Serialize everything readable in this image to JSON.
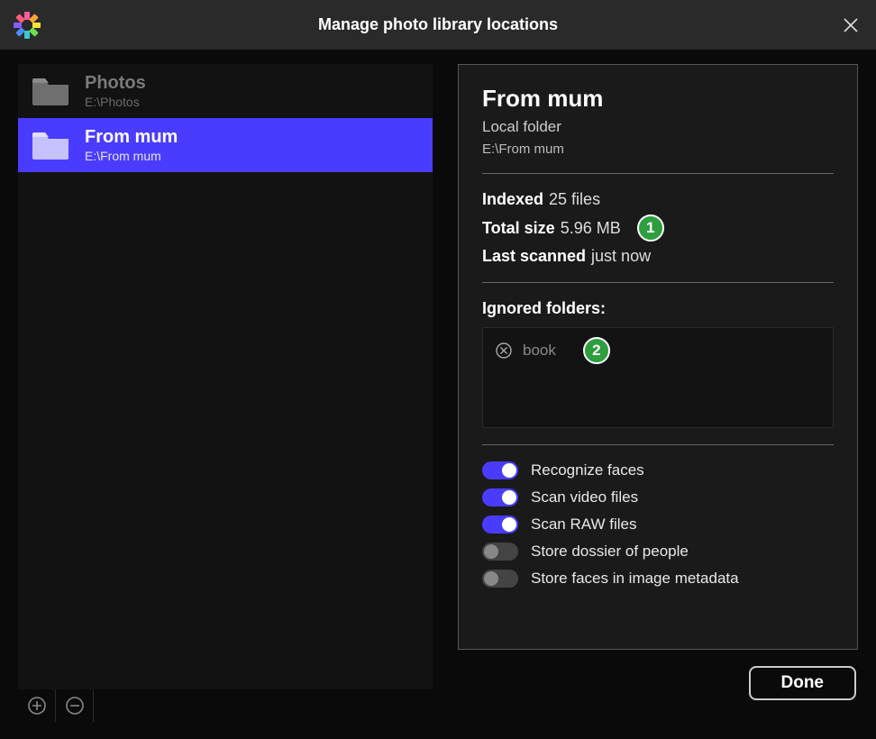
{
  "window": {
    "title": "Manage photo library locations"
  },
  "folders": [
    {
      "name": "Photos",
      "path": "E:\\Photos",
      "selected": false
    },
    {
      "name": "From mum",
      "path": "E:\\From mum",
      "selected": true
    }
  ],
  "detail": {
    "title": "From mum",
    "type": "Local folder",
    "path": "E:\\From mum",
    "indexed_label": "Indexed",
    "indexed_value": "25 files",
    "size_label": "Total size",
    "size_value": "5.96 MB",
    "scanned_label": "Last scanned",
    "scanned_value": "just now",
    "ignored_label": "Ignored folders:",
    "ignored": [
      {
        "name": "book"
      }
    ],
    "options": [
      {
        "key": "recognize_faces",
        "label": "Recognize faces",
        "on": true
      },
      {
        "key": "scan_video",
        "label": "Scan video files",
        "on": true
      },
      {
        "key": "scan_raw",
        "label": "Scan RAW files",
        "on": true
      },
      {
        "key": "store_dossier",
        "label": "Store dossier of people",
        "on": false
      },
      {
        "key": "store_metadata",
        "label": "Store faces in image metadata",
        "on": false
      }
    ]
  },
  "annotations": {
    "badge1": "1",
    "badge2": "2"
  },
  "buttons": {
    "done": "Done"
  }
}
